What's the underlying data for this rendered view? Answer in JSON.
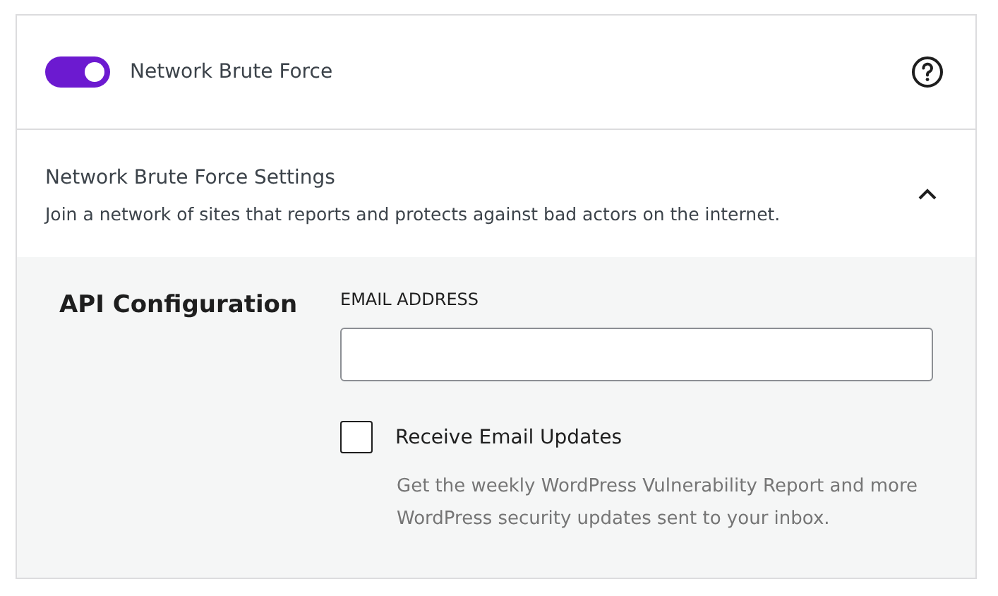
{
  "module": {
    "title": "Network Brute Force",
    "on": true
  },
  "settings": {
    "title": "Network Brute Force Settings",
    "description": "Join a network of sites that reports and protects against bad actors on the internet.",
    "expanded": true
  },
  "api": {
    "heading": "API Configuration",
    "email_label": "EMAIL ADDRESS",
    "updates": {
      "label": "Receive Email Updates",
      "checked": false,
      "hint": "Get the weekly WordPress Vulnerability Report and more WordPress security updates sent to your inbox."
    }
  }
}
